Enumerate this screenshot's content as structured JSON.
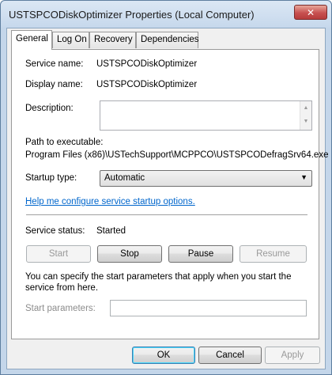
{
  "window": {
    "title": "USTSPCODiskOptimizer Properties (Local Computer)",
    "close_glyph": "✕"
  },
  "tabs": [
    {
      "label": "General",
      "active": true
    },
    {
      "label": "Log On",
      "active": false
    },
    {
      "label": "Recovery",
      "active": false
    },
    {
      "label": "Dependencies",
      "active": false
    }
  ],
  "general": {
    "service_name_label": "Service name:",
    "service_name_value": "USTSPCODiskOptimizer",
    "display_name_label": "Display name:",
    "display_name_value": "USTSPCODiskOptimizer",
    "description_label": "Description:",
    "description_value": "",
    "path_label": "Path to executable:",
    "path_value": "Program Files (x86)\\USTechSupport\\MCPPCO\\USTSPCODefragSrv64.exe",
    "startup_type_label": "Startup type:",
    "startup_type_value": "Automatic",
    "help_link": "Help me configure service startup options.",
    "service_status_label": "Service status:",
    "service_status_value": "Started",
    "start_button": "Start",
    "stop_button": "Stop",
    "pause_button": "Pause",
    "resume_button": "Resume",
    "params_info": "You can specify the start parameters that apply when you start the service from here.",
    "start_params_label": "Start parameters:",
    "start_params_value": ""
  },
  "footer": {
    "ok_button": "OK",
    "cancel_button": "Cancel",
    "apply_button": "Apply"
  },
  "colors": {
    "link": "#0066cc",
    "title_bar": "#c4d6ea",
    "close_button": "#c75050"
  }
}
